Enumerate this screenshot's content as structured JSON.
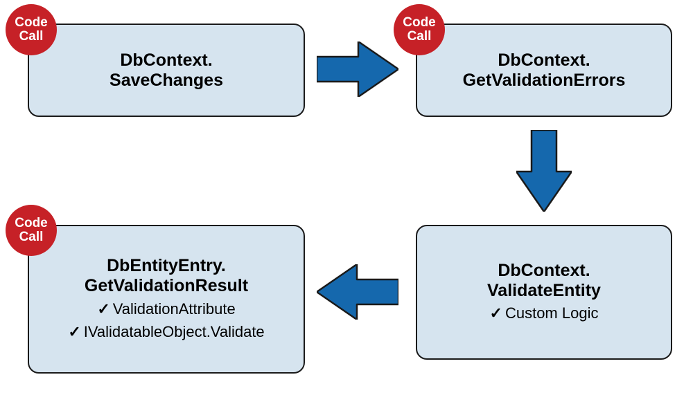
{
  "badges": {
    "codecall": "Code Call"
  },
  "nodes": {
    "save": {
      "title_l1": "DbContext.",
      "title_l2": "SaveChanges"
    },
    "geterrors": {
      "title_l1": "DbContext.",
      "title_l2": "GetValidationErrors"
    },
    "validateentity": {
      "title_l1": "DbContext.",
      "title_l2": "ValidateEntity",
      "detail1": "Custom Logic"
    },
    "getresult": {
      "title_l1": "DbEntityEntry.",
      "title_l2": "GetValidationResult",
      "detail1": "ValidationAttribute",
      "detail2": "IValidatableObject.Validate"
    }
  },
  "glyphs": {
    "check": "✓"
  }
}
